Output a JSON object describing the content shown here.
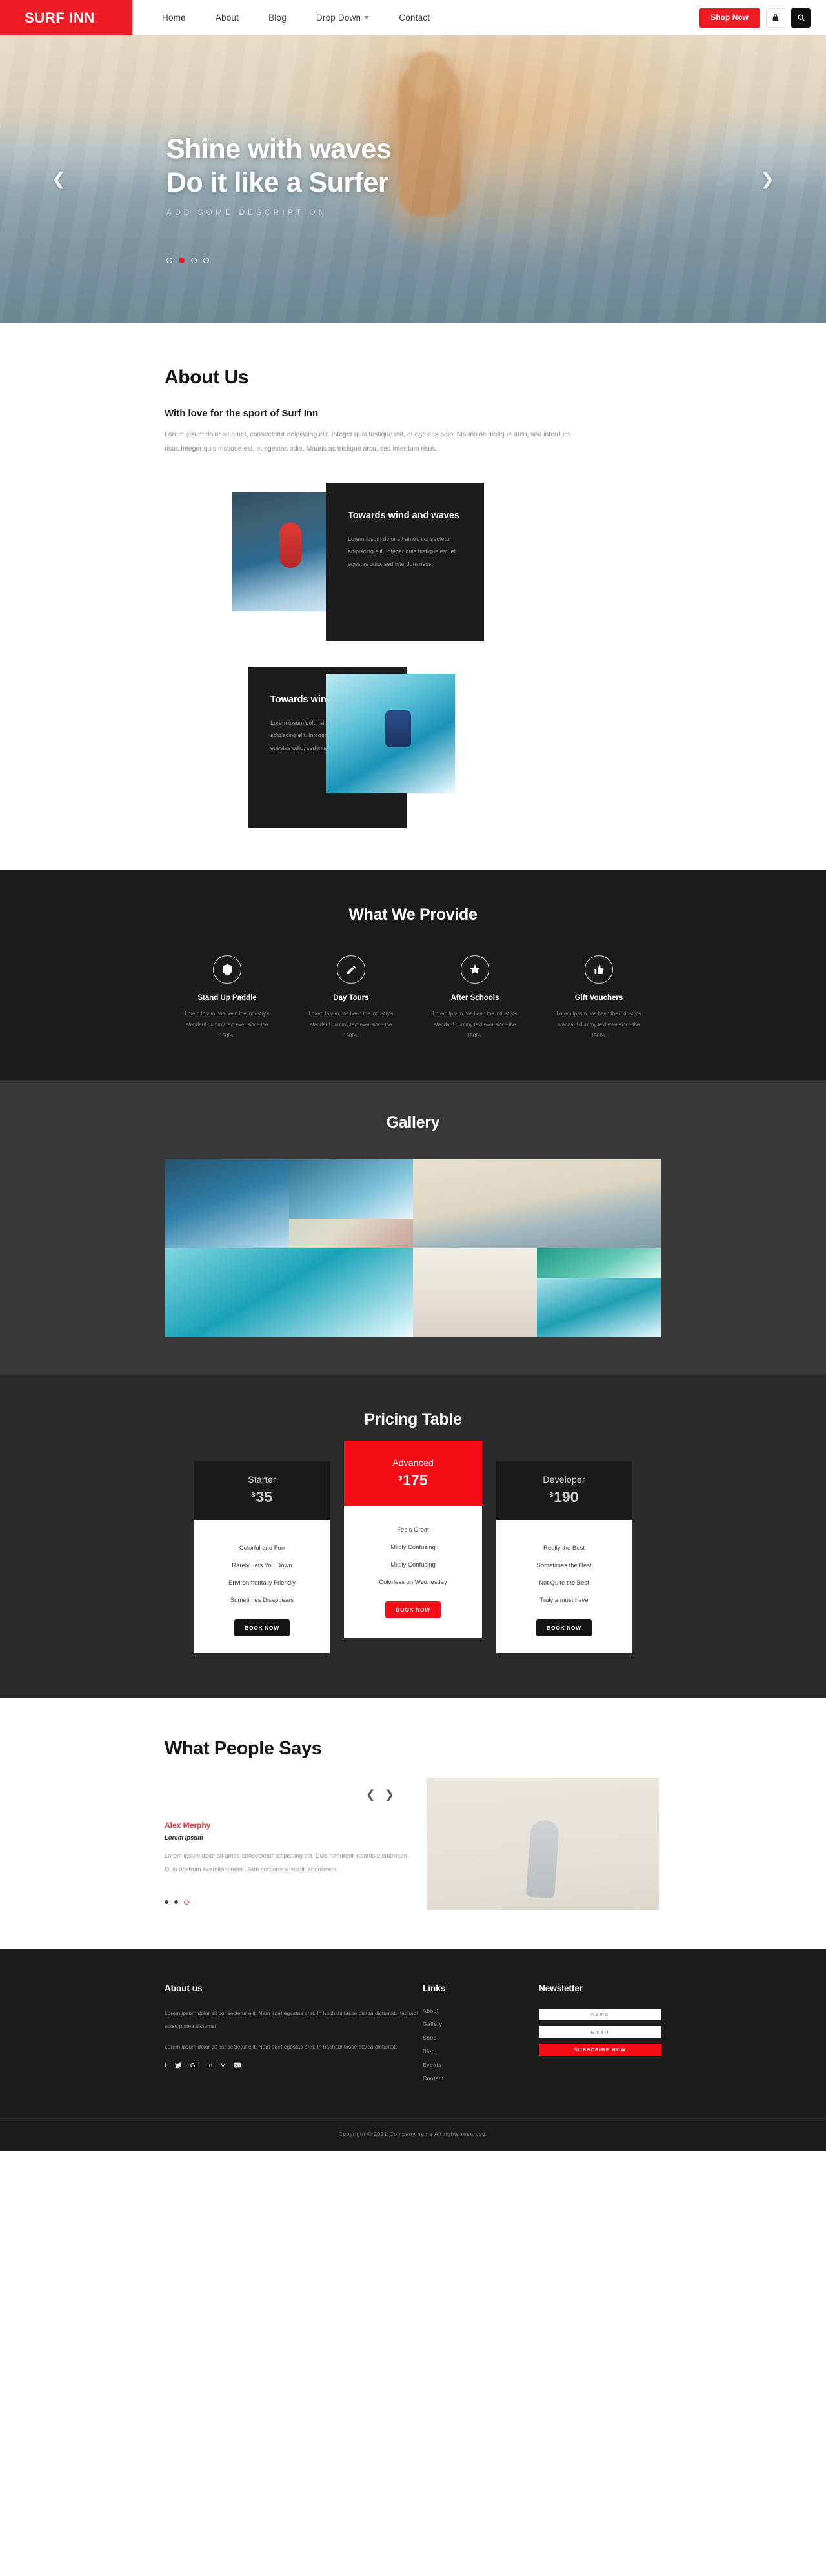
{
  "navbar": {
    "brand": "SURF INN",
    "links": [
      {
        "label": "Home"
      },
      {
        "label": "About"
      },
      {
        "label": "Blog"
      },
      {
        "label": "Drop Down",
        "dropdown": true
      },
      {
        "label": "Contact"
      }
    ],
    "shop_label": "Shop Now",
    "cart_icon": "cart-icon",
    "search_icon": "search-icon"
  },
  "hero": {
    "title_line1": "Shine with waves",
    "title_line2": "Do it like a Surfer",
    "subtitle": "Add Some Description",
    "prev_icon": "chevron-left-icon",
    "next_icon": "chevron-right-icon",
    "slide_count": 4,
    "active_slide": 2
  },
  "about": {
    "title": "About Us",
    "subtitle": "With love for the sport of Surf Inn",
    "lead": "Lorem ipsum dolor sit amet, consectetur adipiscing elit. Integer quis tristique est, et egestas odio. Mauris ac tristique arcu, sed interdum risus.Integer quis tristique est, et egestas odio. Mauris ac tristique arcu, sed interdum risus.",
    "cards": [
      {
        "title": "Towards wind and waves",
        "text": "Lorem ipsum dolor sit amet, consectetur adipiscing elit. Integer quis tristique est, et egestas odio, sed interdum risus."
      },
      {
        "title": "Towards wind and waves",
        "text": "Lorem ipsum dolor sit amet, consectetur adipiscing elit. Integer quis tristique est, et egestas odio, sed interdum risus."
      }
    ]
  },
  "provide": {
    "title": "What We Provide",
    "items": [
      {
        "icon": "shield-icon",
        "title": "Stand Up Paddle",
        "text": "Lorem Ipsum has been the industry's standard dummy text ever since the 1500s."
      },
      {
        "icon": "pencil-icon",
        "title": "Day Tours",
        "text": "Lorem Ipsum has been the industry's standard dummy text ever since the 1500s."
      },
      {
        "icon": "star-icon",
        "title": "After Schools",
        "text": "Lorem Ipsum has been the industry's standard dummy text ever since the 1500s."
      },
      {
        "icon": "thumbs-up-icon",
        "title": "Gift Vouchers",
        "text": "Lorem Ipsum has been the industry's standard dummy text ever since the 1500s."
      }
    ]
  },
  "gallery": {
    "title": "Gallery",
    "image_count": 8
  },
  "pricing": {
    "title": "Pricing Table",
    "plans": [
      {
        "name": "Starter",
        "currency": "$",
        "price": "35",
        "featured": false,
        "features": [
          "Colorful and Fun",
          "Rarely Lets You Down",
          "Environmentally Friendly",
          "Sometimes Disappears"
        ],
        "cta": "BOOK NOW"
      },
      {
        "name": "Advanced",
        "currency": "$",
        "price": "175",
        "featured": true,
        "features": [
          "Feels Great",
          "Mildly Confusing",
          "Mildly Confusing",
          "Colorless on Wednesday"
        ],
        "cta": "BOOK NOW"
      },
      {
        "name": "Developer",
        "currency": "$",
        "price": "190",
        "featured": false,
        "features": [
          "Really the Best",
          "Sometimes the Best",
          "Not Quite the Best",
          "Truly a must have"
        ],
        "cta": "BOOK NOW"
      }
    ]
  },
  "testimonials": {
    "title": "What People Says",
    "prev_icon": "chevron-left-icon",
    "next_icon": "chevron-right-icon",
    "name": "Alex Merphy",
    "role": "Lorem Ipsum",
    "text": "Lorem ipsum dolor sit amet, consectetur adipiscing elit. Duis hendrerit lobortis elementum. Quis nostrum exercitationem ullam corporis suscipit laboriosam.",
    "dot_count": 3,
    "active_dot": 3
  },
  "footer": {
    "about_title": "About us",
    "about_p1": "Lorem ipsum dolor sit consectetur elit. Nam eget egestas erat. In hachabi tasse platea dictumst. hachabi tasse platea dictumst",
    "about_p2": "Lorem ipsum dolor sit consectetur elit. Nam eget egestas erat. In hachabi tasse platea dictumst.",
    "socials": [
      {
        "icon": "facebook-icon",
        "glyph": "f"
      },
      {
        "icon": "twitter-icon",
        "glyph": "🐦"
      },
      {
        "icon": "google-plus-icon",
        "glyph": "G+"
      },
      {
        "icon": "linkedin-icon",
        "glyph": "in"
      },
      {
        "icon": "vimeo-icon",
        "glyph": "V"
      },
      {
        "icon": "youtube-icon",
        "glyph": "▶"
      }
    ],
    "links_title": "Links",
    "links": [
      "About",
      "Gallery",
      "Shop",
      "Blog",
      "Events",
      "Contact"
    ],
    "newsletter_title": "Newsletter",
    "name_placeholder": "Name",
    "email_placeholder": "Email",
    "subscribe_label": "SUBSCRIBE NOW",
    "copyright": "Copyright © 2021.Company name All rights reserved."
  },
  "colors": {
    "accent": "#ee1c25",
    "accent_bright": "#f40c17",
    "dark": "#1c1c1c",
    "gallery_bg": "#373737",
    "pricing_bg": "#2b2b2b"
  }
}
